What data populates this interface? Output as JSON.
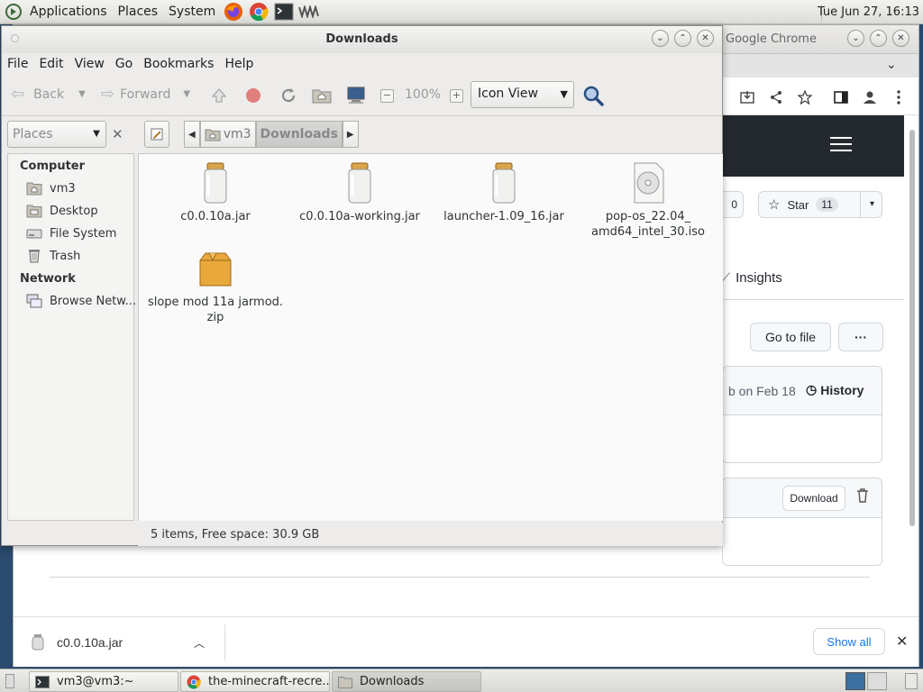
{
  "top_panel": {
    "menus": [
      "Applications",
      "Places",
      "System"
    ],
    "clock": "Tue Jun 27, 16:13"
  },
  "chrome": {
    "title": "Google Chrome",
    "star_label": "Star",
    "star_count": "11",
    "watch_count": "0",
    "insights_label": "Insights",
    "go_to_file_label": "Go to file",
    "commit_text": "b on Feb 18",
    "history_label": "History",
    "download_button_label": "Download",
    "download_item": "c0.0.10a.jar",
    "show_all_label": "Show all"
  },
  "nautilus": {
    "title": "Downloads",
    "menus": [
      "File",
      "Edit",
      "View",
      "Go",
      "Bookmarks",
      "Help"
    ],
    "toolbar": {
      "back_label": "Back",
      "forward_label": "Forward",
      "zoom": "100%",
      "view_mode": "Icon View"
    },
    "places_placeholder": "Places",
    "path": [
      "vm3",
      "Downloads"
    ],
    "sidebar": {
      "computer_heading": "Computer",
      "computer_items": [
        "vm3",
        "Desktop",
        "File System",
        "Trash"
      ],
      "network_heading": "Network",
      "network_items": [
        "Browse Netw..."
      ]
    },
    "files": [
      {
        "name": "c0.0.10a.jar",
        "icon": "jar-icon"
      },
      {
        "name": "c0.0.10a-working.jar",
        "icon": "jar-icon"
      },
      {
        "name": "launcher-1.09_16.jar",
        "icon": "jar-icon"
      },
      {
        "name": "pop-os_22.04_\namd64_intel_30.iso",
        "icon": "disc-image-icon"
      },
      {
        "name": "slope mod 11a jarmod.\nzip",
        "icon": "archive-icon"
      }
    ],
    "status": "5 items, Free space: 30.9 GB"
  },
  "bottom_panel": {
    "tasks": [
      "vm3@vm3:~",
      "the-minecraft-recre...",
      "Downloads"
    ]
  }
}
